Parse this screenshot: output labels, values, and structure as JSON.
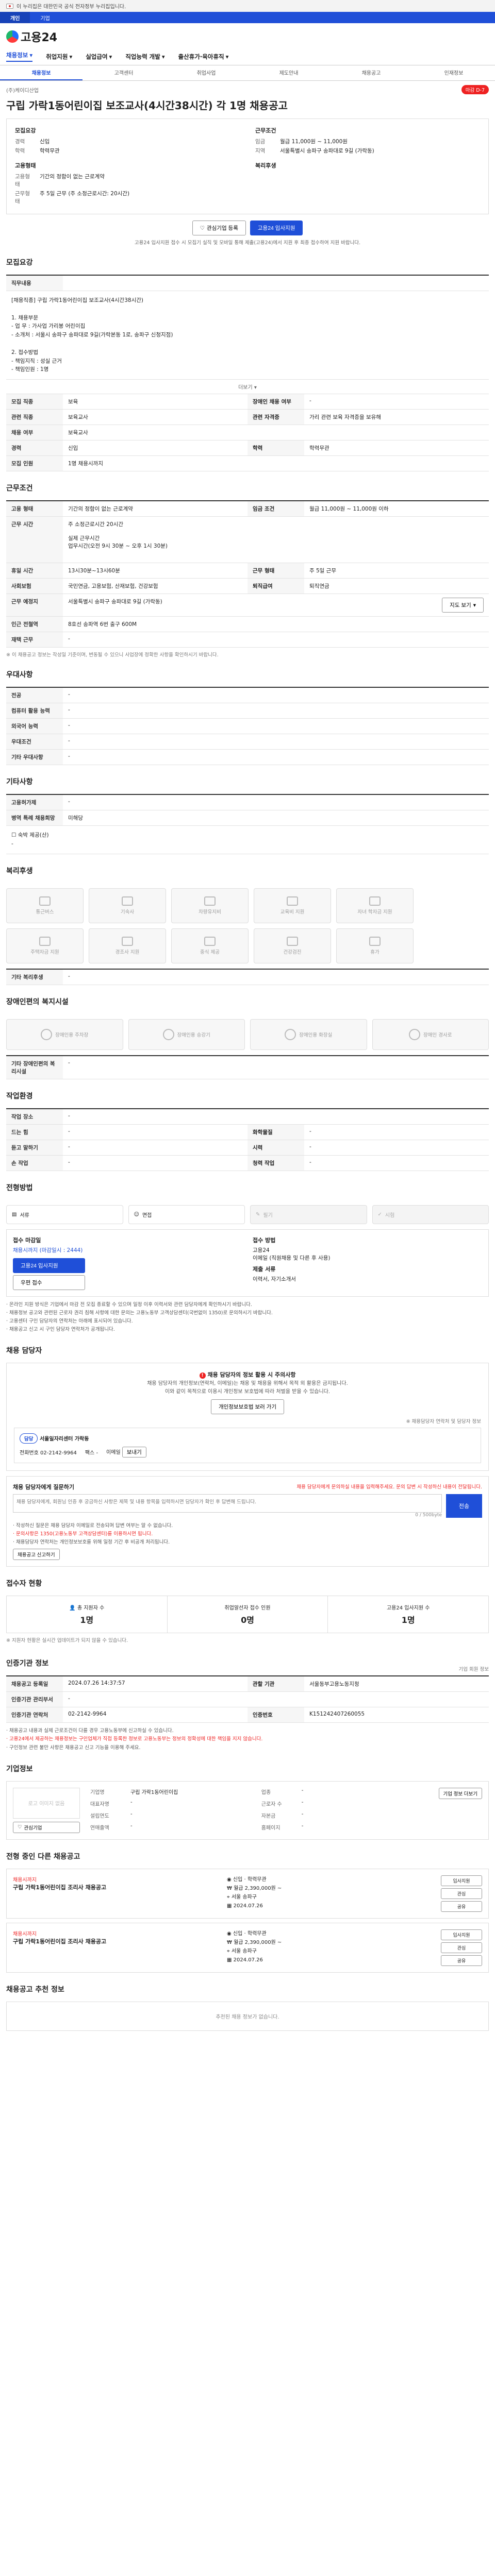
{
  "gov_banner": "이 누리집은 대한민국 공식 전자정부 누리집입니다.",
  "topbar": [
    "개인",
    "기업"
  ],
  "logo": "고용24",
  "gnb": [
    "채용정보",
    "취업지원",
    "실업급여",
    "직업능력 개발",
    "출산휴가·육아휴직"
  ],
  "subnav": [
    "채용정보",
    "고객센터",
    "취업사업",
    "제도안내",
    "채용공고",
    "인재정보"
  ],
  "company": {
    "name": "(주)케이디산업",
    "badge": "마감 D-7"
  },
  "title": "구립 가락1동어린이집 보조교사(4시간38시간) 각 1명 채용공고",
  "summary": {
    "left_title": "모집요강",
    "left": [
      {
        "k": "경력",
        "v": "신입"
      },
      {
        "k": "학력",
        "v": "학력무관"
      }
    ],
    "right_title": "근무조건",
    "right": [
      {
        "k": "임금",
        "v": "월급 11,000원 ~ 11,000원"
      },
      {
        "k": "지역",
        "v": "서울특별시 송파구 송파대로 9길 (가락동)"
      }
    ],
    "emp_title": "고용형태",
    "emp": [
      {
        "k": "고용형태",
        "v": "기간의 정함이 없는 근로계약"
      },
      {
        "k": "근무형태",
        "v": "주 5일 근무 (주 소정근로시간: 20시간)"
      }
    ],
    "welfare_title": "복리후생"
  },
  "buttons": {
    "interest": "관심기업 등록",
    "apply": "고용24 입사지원"
  },
  "apply_note": "고용24 입사지원 접수 시 모집기 실직 및 모바일 통해 제출(고용24)에서 지원 후 최종 접수하여 지원 바랍니다.",
  "job_section": {
    "title": "모집요강",
    "duty_label": "직무내용",
    "duty_text": "[채용직종] 구립 가락1동어린이집 보조교사(4시간38시간)\n\n1. 채용부문\n - 업 무 : 가사업 가리봉 어린이집\n - 소개처 : 서울시 송파구 송파대로 9길(가락본동 1로, 송파구 신청지점)\n\n2. 접수방법\n - 책임지직 : 성실 근거\n - 책임인원 : 1명",
    "more": "더보기",
    "rows": [
      {
        "th": "모집 직종",
        "td": "보육",
        "th2": "장애인 채용 여부",
        "td2": "-"
      },
      {
        "th": "관련 직종",
        "td": "보육교사",
        "th2": "관련 자격증",
        "td2": "가리 관련 보육 자격증을 보유해"
      },
      {
        "th": "채용 여부",
        "td": "보육교사",
        "th2": "",
        "td2": ""
      },
      {
        "th": "경력",
        "td": "신입",
        "th2": "학력",
        "td2": "학력무관"
      },
      {
        "th": "모집 인원",
        "td": "1명  채용시까지",
        "th2": "",
        "td2": ""
      }
    ]
  },
  "work_section": {
    "title": "근무조건",
    "rows": [
      {
        "th": "고용 형태",
        "td": "기간의 정함이 없는 근로계약",
        "th2": "임금 조건",
        "td2": "월급 11,000원 ~ 11,000원 이하"
      },
      {
        "th": "근무 시간",
        "td": "주 소정근로시간 20시간\n\n실제 근무시간\n업무시간(오전 9시 30분 ~ 오후 1시 30분)"
      },
      {
        "th": "휴일 시간",
        "td": "13시30분~13시60분",
        "th2": "근무 형태",
        "td2": "주 5일 근무"
      },
      {
        "th": "사회보험",
        "td": "국민연금, 고용보험, 산재보험, 건강보험",
        "th2": "퇴직급여",
        "td2": "퇴직연금"
      },
      {
        "th": "근무 예정지",
        "td": "서울특별시 송파구 송파대로 9길 (가락동)",
        "th2": "",
        "td2": "지도 보기"
      },
      {
        "th": "인근 전철역",
        "td": "8호선 송파역 6번 출구 600M"
      },
      {
        "th": "재택 근무",
        "td": "-"
      }
    ],
    "note": "※ 이 채용공고 정보는 작성일 기준이며, 변동될 수 있으니 사업장에 정확한 사항을 확인하시기 바랍니다."
  },
  "pref_section": {
    "title": "우대사항",
    "rows": [
      {
        "th": "전공",
        "td": "-"
      },
      {
        "th": "컴퓨터 활용 능력",
        "td": "-"
      },
      {
        "th": "외국어 능력",
        "td": "-"
      },
      {
        "th": "우대조건",
        "td": "-"
      },
      {
        "th": "기타 우대사항",
        "td": "-"
      }
    ]
  },
  "etc_section": {
    "title": "기타사항",
    "rows": [
      {
        "th": "고용허가제",
        "td": "-"
      },
      {
        "th": "병역 특례 채용희망",
        "td": "미해당"
      }
    ],
    "check": "숙박 제공(산)",
    "check2": "-"
  },
  "welfare_section": {
    "title": "복리후생",
    "items": [
      "통근버스",
      "기숙사",
      "차량유지비",
      "교육비 지원",
      "자녀 학자금 지원",
      "주택자금 지원",
      "경조사 지원",
      "중식 제공",
      "건강검진",
      "휴가"
    ],
    "other_label": "기타 복리후생",
    "other_value": "-"
  },
  "disability_section": {
    "title": "장애인편의 복지시설",
    "items": [
      "장애인용 주차장",
      "장애인용 승강기",
      "장애인용 화장실",
      "장애인 경사로"
    ],
    "other_label": "기타 장애인편의 복리시설",
    "other_value": "-"
  },
  "worksite_section": {
    "title": "작업환경",
    "rows": [
      {
        "th": "작업 장소",
        "td": "-",
        "th2": "",
        "td2": ""
      },
      {
        "th": "드는 힘",
        "td": "-",
        "th2": "화학물질",
        "td2": "-"
      },
      {
        "th": "듣고 말하기",
        "td": "-",
        "th2": "시력",
        "td2": "-"
      },
      {
        "th": "손 작업",
        "td": "-",
        "th2": "청력 작업",
        "td2": "-"
      }
    ]
  },
  "docs_section": {
    "title": "전형방법",
    "items": [
      "서류",
      "면접",
      "필기",
      "시험"
    ]
  },
  "apply_section": {
    "left_title": "접수 마감일",
    "deadline": "채용시까지 (마감일시 : 2444)",
    "apply_btn": "고용24 입사지원",
    "mail_btn": "우편 접수",
    "right_title": "접수 방법",
    "method": "고용24\n이메일 (직원채용 및 다른 후 사용)",
    "doc_title": "제출 서류",
    "doc": "이력서, 자기소개서",
    "bullets": [
      "온라인 지원 방식은 기업에서 마감 전 모집 종료할 수 있으며 일정 이후 이력서와 관련 담당자에게 확인하시기 바랍니다.",
      "채용정보 공고와 관련된 근로자 권리 침해 사항에 대한 문의는 고용노동부 고객상담센터(국번없이 1350)로 문의하시기 바랍니다.",
      "고용센터 구인 담당자의 연락처는 아래에 표시되어 있습니다.",
      "채용공고 신고 시 구인 담당자 연락처가 공개됩니다."
    ]
  },
  "contact_section": {
    "title": "채용 담당자",
    "alert_head": "채용 담당자의 정보 활용 시 주의사항",
    "alert_body": "채용 담당자의 개인정보(연락처, 이메일)는 채용 및 채용을 위해서 목적 외 활용은 금지됩니다.\n이와 같이 목적으로 이용시 개인정보 보호법에 따라 처벌을 받을 수 있습니다.",
    "alert_btn": "개인정보보호법 보러 가기",
    "sub_label": "※ 채용담당자 연락처 및 담당자 정보",
    "org": "서울일자리센터 가락동",
    "phone_label": "전화번호",
    "phone": "02-2142-9964",
    "fax_label": "팩스",
    "fax": "-",
    "mail_label": "이메일",
    "mail_btn": "보내기",
    "q_title": "채용 담당자에게 질문하기",
    "q_note": "채용 담당자에게 문의하실 내용을 입력해주세요. 문의 답변 시 작성하신 내용이 전달됩니다.",
    "q_placeholder": "채용 담당자에게, 회원님 인증 후 궁금하신 사항은 제목 및 내용 항목을 입력하시면 담당자가 확인 후 답변해 드립니다.",
    "q_count": "0 / 500byte",
    "q_send": "전송",
    "q_bullets": [
      "작성하신 질문은 채용 담당자 이메일로 전송되며 답변 여부는 알 수 없습니다.",
      "문의사항은 1350(고용노동부 고객상담센터)를 이용하시면 됩니다.",
      "채용담당자 연락처는 개인정보보호를 위해 일정 기간 후 비공개 처리됩니다."
    ],
    "q_report": "채용공고 신고하기"
  },
  "stats_section": {
    "title": "접수자 현황",
    "items": [
      {
        "label": "총 지원자 수",
        "value": "1명"
      },
      {
        "label": "취업알선자 접수 인원",
        "value": "0명"
      },
      {
        "label": "고용24 입사지원 수",
        "value": "1명"
      }
    ],
    "note": "※ 지원자 현황은 실시간 업데이트가 되지 않을 수 있습니다."
  },
  "manage_section": {
    "title": "인증기관 정보",
    "right": "기업 회원 정보",
    "rows": [
      {
        "th": "채용공고 등록일",
        "td": "2024.07.26 14:37:57",
        "th2": "관할 기관",
        "td2": "서울동부고용노동지청"
      },
      {
        "th": "인증기관 관리부서",
        "td": "-",
        "th2": "",
        "td2": ""
      },
      {
        "th": "인증기관 연락처",
        "td": "02-2142-9964",
        "th2": "인증번호",
        "td2": "K151242407260055"
      }
    ],
    "bullets": [
      "채용공고 내용과 실제 근로조건이 다를 경우 고용노동부에 신고하실 수 있습니다.",
      "고용24에서 제공하는 채용정보는 구인업체가 직접 등록한 정보로 고용노동부는 정보의 정확성에 대한 책임을 지지 않습니다.",
      "구인정보 관련 불만 사항은 채용공고 신고 기능을 이용해 주세요."
    ]
  },
  "company_section": {
    "title": "기업정보",
    "logo_alt": "로고 이미지 없음",
    "btn_interest": "관심기업",
    "btn_more": "기업 정보 더보기",
    "rows": [
      {
        "k": "기업명",
        "v": "구립 가락1동어린이집",
        "k2": "업종",
        "v2": "-"
      },
      {
        "k": "대표자명",
        "v": "-",
        "k2": "근로자 수",
        "v2": "-"
      },
      {
        "k": "설립연도",
        "v": "-",
        "k2": "자본금",
        "v2": "-"
      },
      {
        "k": "연매출액",
        "v": "-",
        "k2": "홈페이지",
        "v2": "-"
      }
    ]
  },
  "similar_section": {
    "title": "전형 중인 다른 채용공고",
    "jobs": [
      {
        "tag": "채용시까지",
        "name": "구립 가락1동어린이집 조리사 채용공고",
        "career": "신입",
        "edu": "학력무관",
        "pay": "월급 2,390,000원 ~",
        "loc": "서울 송파구",
        "date": "2024.07.26"
      },
      {
        "tag": "채용시까지",
        "name": "구립 가락1동어린이집 조리사 채용공고",
        "career": "신입",
        "edu": "학력무관",
        "pay": "월급 2,390,000원 ~",
        "loc": "서울 송파구",
        "date": "2024.07.26"
      }
    ],
    "btn_apply": "입사지원",
    "btn_interest": "관심",
    "btn_share": "공유"
  },
  "recommend_section": {
    "title": "채용공고 추천 정보",
    "empty": "추천된 채용 정보가 없습니다."
  }
}
